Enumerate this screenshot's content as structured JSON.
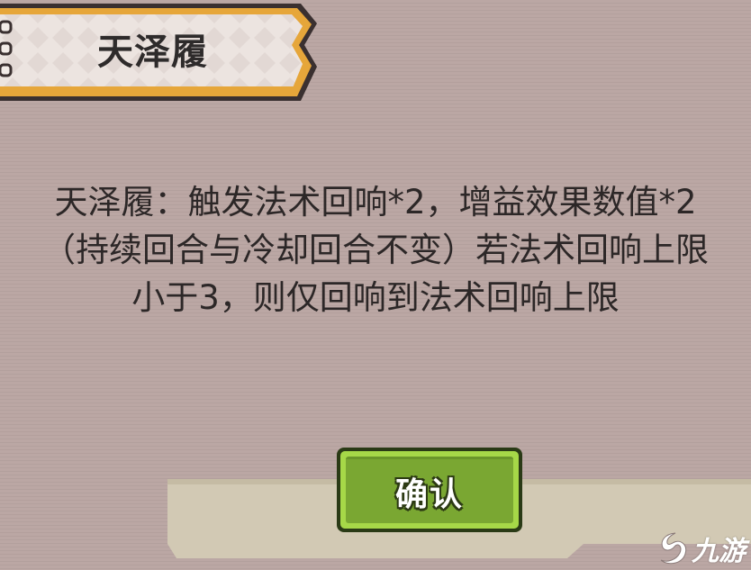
{
  "skill": {
    "name": "天泽履",
    "description": "天泽履：触发法术回响*2，增益效果数值*2（持续回合与冷却回合不变）若法术回响上限小于3，则仅回响到法术回响上限"
  },
  "dialog": {
    "confirm_label": "确认"
  },
  "watermark": {
    "text": "九游"
  },
  "colors": {
    "background": "#b9a5a2",
    "banner_fill": "#ece4e0",
    "banner_border": "#e6a63a",
    "banner_outline": "#3a3030",
    "button_face": "#7aa732",
    "button_highlight": "#a6d848",
    "button_outline": "#2a3a16",
    "text_dark": "#2c2727"
  },
  "icons": {
    "watermark_logo": "jiuyou-logo-icon"
  }
}
